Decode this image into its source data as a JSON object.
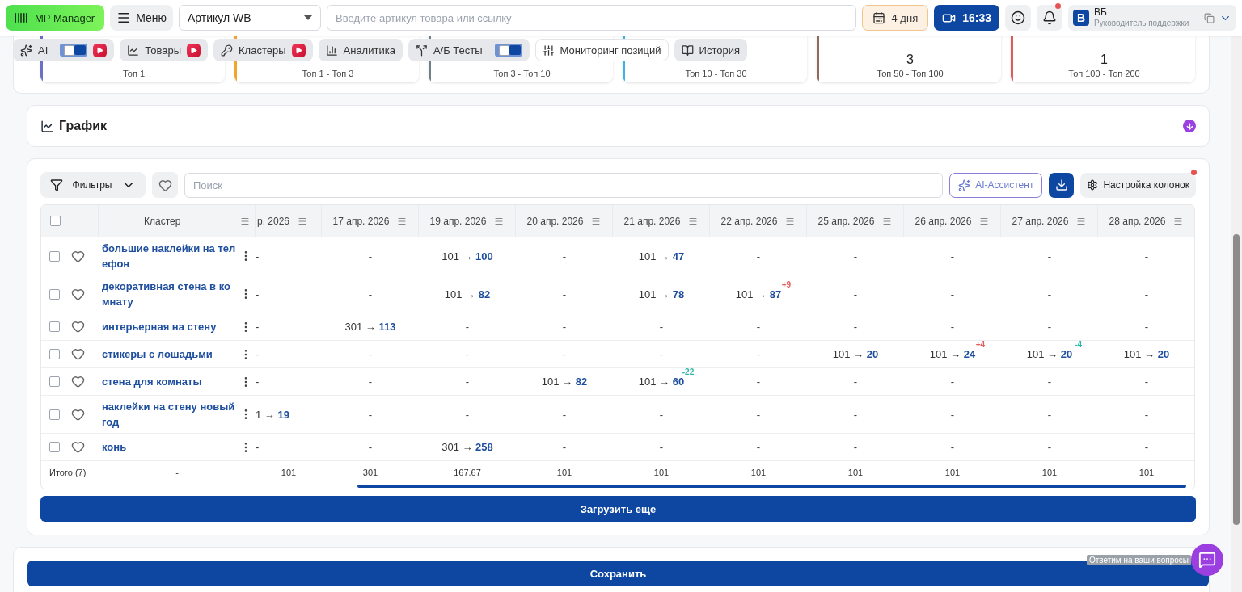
{
  "header": {
    "logo": "MP Manager",
    "menu": "Меню",
    "article_select": "Артикул WB",
    "search_placeholder": "Введите артикул товара или ссылку",
    "days": "4 дня",
    "time": "16:33",
    "notification": true,
    "user": {
      "initial": "В",
      "name": "ВБ",
      "role": "Руководитель поддержки"
    }
  },
  "tabs": [
    {
      "label": "AI",
      "switch": true,
      "video_badge": true,
      "selected": false
    },
    {
      "label": "Товары",
      "video_badge": true,
      "selected": false
    },
    {
      "label": "Кластеры",
      "video_badge": true,
      "selected": false
    },
    {
      "label": "Аналитика",
      "video_badge": false,
      "selected": false
    },
    {
      "label": "А/Б Тесты",
      "switch": true,
      "video_badge": false,
      "selected": false
    },
    {
      "label": "Мониторинг позиций",
      "video_badge": false,
      "selected": true
    },
    {
      "label": "История",
      "video_badge": false,
      "selected": false
    }
  ],
  "stat_cards": [
    {
      "label": "Топ 1",
      "color": "#6b70c6"
    },
    {
      "label": "Топ 1 - Топ 3",
      "color": "#f0a531"
    },
    {
      "label": "Топ 3 - Топ 10",
      "color": "#6f8088"
    },
    {
      "label": "Топ 10 - Топ 30",
      "color": "#3db3e3"
    },
    {
      "value": "3",
      "label": "Топ 50 - Топ 100",
      "color": "#8c6c5d"
    },
    {
      "value": "1",
      "label": "Топ 100 - Топ 200",
      "color": "#e05b5b"
    }
  ],
  "chart_panel": {
    "title": "График"
  },
  "toolbar": {
    "filters": "Фильтры",
    "search_placeholder": "Поиск",
    "ai_assistant": "AI-Ассистент",
    "column_settings": "Настройка колонок",
    "column_settings_alert": true
  },
  "table": {
    "select_all_checked": false,
    "cluster_column": "Кластер",
    "date_columns": [
      "р. 2026",
      "17 апр. 2026",
      "19 апр. 2026",
      "20 апр. 2026",
      "21 апр. 2026",
      "22 апр. 2026",
      "25 апр. 2026",
      "26 апр. 2026",
      "27 апр. 2026",
      "28 апр. 2026"
    ],
    "rows": [
      {
        "cluster": "большие наклейки на телефон",
        "checked": false,
        "favorite": false,
        "cells": [
          {
            "text": "-"
          },
          {
            "text": "-"
          },
          {
            "text": "101 → **100**"
          },
          {
            "text": "-"
          },
          {
            "text": "101 → **47**"
          },
          {
            "text": "-"
          },
          {
            "text": "-"
          },
          {
            "text": "-"
          },
          {
            "text": "-"
          },
          {
            "text": "-"
          }
        ]
      },
      {
        "cluster": "декоративная стена в комнату",
        "checked": false,
        "favorite": false,
        "cells": [
          {
            "text": "-"
          },
          {
            "text": "-"
          },
          {
            "text": "101 → **82**"
          },
          {
            "text": "-"
          },
          {
            "text": "101 → **78**"
          },
          {
            "text": "101 → **87**",
            "delta": "+9",
            "color": "#e35d5d"
          },
          {
            "text": "-"
          },
          {
            "text": "-"
          },
          {
            "text": "-"
          },
          {
            "text": "-"
          }
        ]
      },
      {
        "cluster": "интерьерная на стену",
        "checked": false,
        "favorite": false,
        "cells": [
          {
            "text": "-"
          },
          {
            "text": "301 → **113**"
          },
          {
            "text": "-"
          },
          {
            "text": "-"
          },
          {
            "text": "-"
          },
          {
            "text": "-"
          },
          {
            "text": "-"
          },
          {
            "text": "-"
          },
          {
            "text": "-"
          },
          {
            "text": "-"
          }
        ]
      },
      {
        "cluster": "стикеры с лошадьми",
        "checked": false,
        "favorite": false,
        "cells": [
          {
            "text": "-"
          },
          {
            "text": "-"
          },
          {
            "text": "-"
          },
          {
            "text": "-"
          },
          {
            "text": "-"
          },
          {
            "text": "-"
          },
          {
            "text": "101 → **20**"
          },
          {
            "text": "101 → **24**",
            "delta": "+4",
            "color": "#e35d5d"
          },
          {
            "text": "101 → **20**",
            "delta": "-4",
            "color": "#2cb5a8"
          },
          {
            "text": "101 → **20**"
          }
        ]
      },
      {
        "cluster": "стена для комнаты",
        "checked": false,
        "favorite": false,
        "cells": [
          {
            "text": "-"
          },
          {
            "text": "-"
          },
          {
            "text": "-"
          },
          {
            "text": "101 → **82**"
          },
          {
            "text": "101 → **60**",
            "delta": "-22",
            "color": "#2cb5a8"
          },
          {
            "text": "-"
          },
          {
            "text": "-"
          },
          {
            "text": "-"
          },
          {
            "text": "-"
          },
          {
            "text": "-"
          }
        ]
      },
      {
        "cluster": "наклейки на стену новый год",
        "checked": false,
        "favorite": false,
        "cells": [
          {
            "text": "1 → **19**"
          },
          {
            "text": "-"
          },
          {
            "text": "-"
          },
          {
            "text": "-"
          },
          {
            "text": "-"
          },
          {
            "text": "-"
          },
          {
            "text": "-"
          },
          {
            "text": "-"
          },
          {
            "text": "-"
          },
          {
            "text": "-"
          }
        ]
      },
      {
        "cluster": "конь",
        "checked": false,
        "favorite": false,
        "cells": [
          {
            "text": "-"
          },
          {
            "text": "-"
          },
          {
            "text": "301 → **258**"
          },
          {
            "text": "-"
          },
          {
            "text": "-"
          },
          {
            "text": "-"
          },
          {
            "text": "-"
          },
          {
            "text": "-"
          },
          {
            "text": "-"
          },
          {
            "text": "-"
          }
        ]
      }
    ],
    "totals": {
      "label": "Итого (7)",
      "cluster": "-",
      "values": [
        "101",
        "301",
        "167.67",
        "101",
        "101",
        "101",
        "101",
        "101",
        "101",
        "101"
      ]
    }
  },
  "load_more": "Загрузить еще",
  "save": "Сохранить",
  "chat": {
    "tooltip": "Ответим на ваши вопросы"
  }
}
